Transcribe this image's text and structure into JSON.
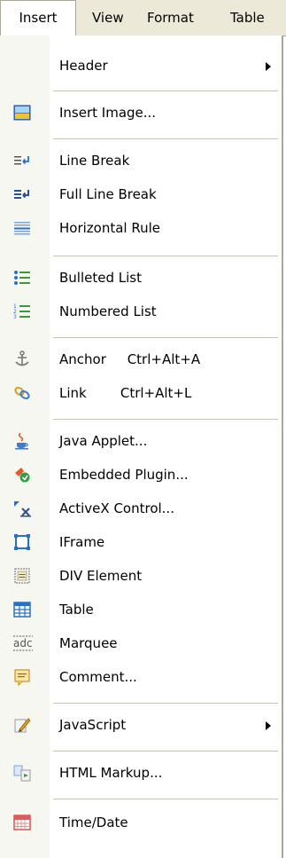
{
  "menubar": {
    "insert": "Insert",
    "view": "View",
    "format": "Format",
    "table": "Table"
  },
  "menu": {
    "header": "Header",
    "insert_image": "Insert Image...",
    "line_break": "Line Break",
    "full_line_break": "Full Line Break",
    "horizontal_rule": "Horizontal Rule",
    "bulleted_list": "Bulleted List",
    "numbered_list": "Numbered List",
    "anchor": "Anchor     Ctrl+Alt+A",
    "link": "Link        Ctrl+Alt+L",
    "java_applet": "Java Applet...",
    "embedded_plugin": "Embedded Plugin...",
    "activex_control": "ActiveX Control...",
    "iframe": "IFrame",
    "div_element": "DIV Element",
    "table": "Table",
    "marquee": "Marquee",
    "comment": "Comment...",
    "javascript": "JavaScript",
    "html_markup": "HTML Markup...",
    "time_date": "Time/Date"
  }
}
